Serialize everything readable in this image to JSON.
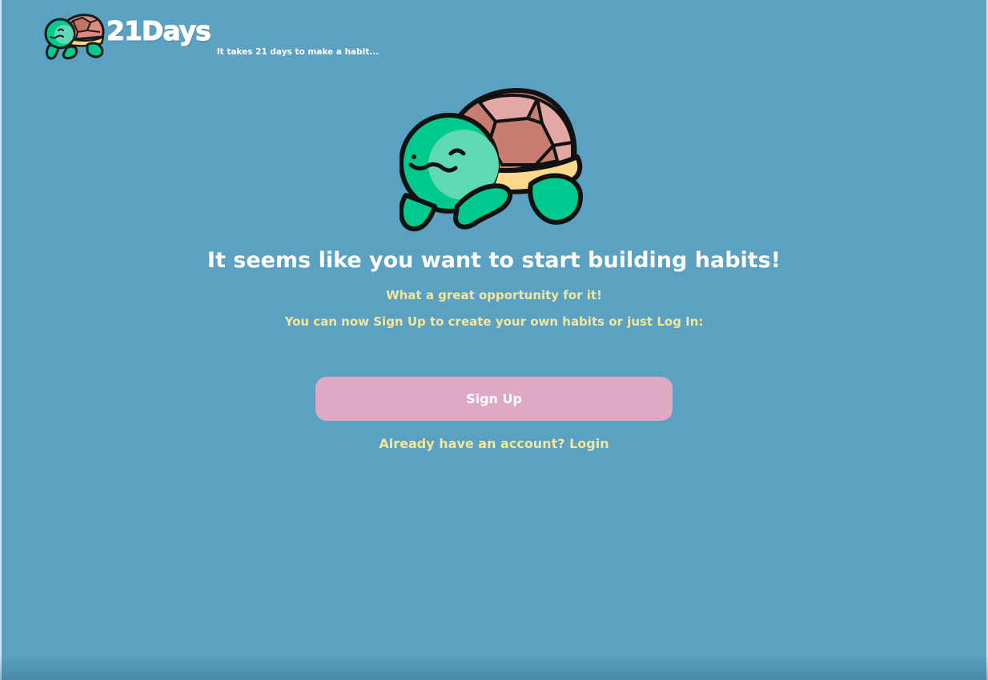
{
  "header": {
    "brand_name": "21Days",
    "tagline": "It takes 21 days to make a habit..."
  },
  "main": {
    "title": "It seems like you want to start building habits!",
    "subtitle": "What a great opportunity for it!",
    "instruction": "You can now Sign Up to create your own habits or just Log In:",
    "signup_label": "Sign Up",
    "login_link": "Already have an account? Login"
  },
  "icons": {
    "logo": "turtle-logo-icon",
    "hero": "turtle-illustration"
  },
  "colors": {
    "background": "#5aa1c2",
    "accent_text": "#f3e79b",
    "button": "#dfa9c3",
    "turtle_green": "#00c98d",
    "shell": "#c97c70"
  }
}
